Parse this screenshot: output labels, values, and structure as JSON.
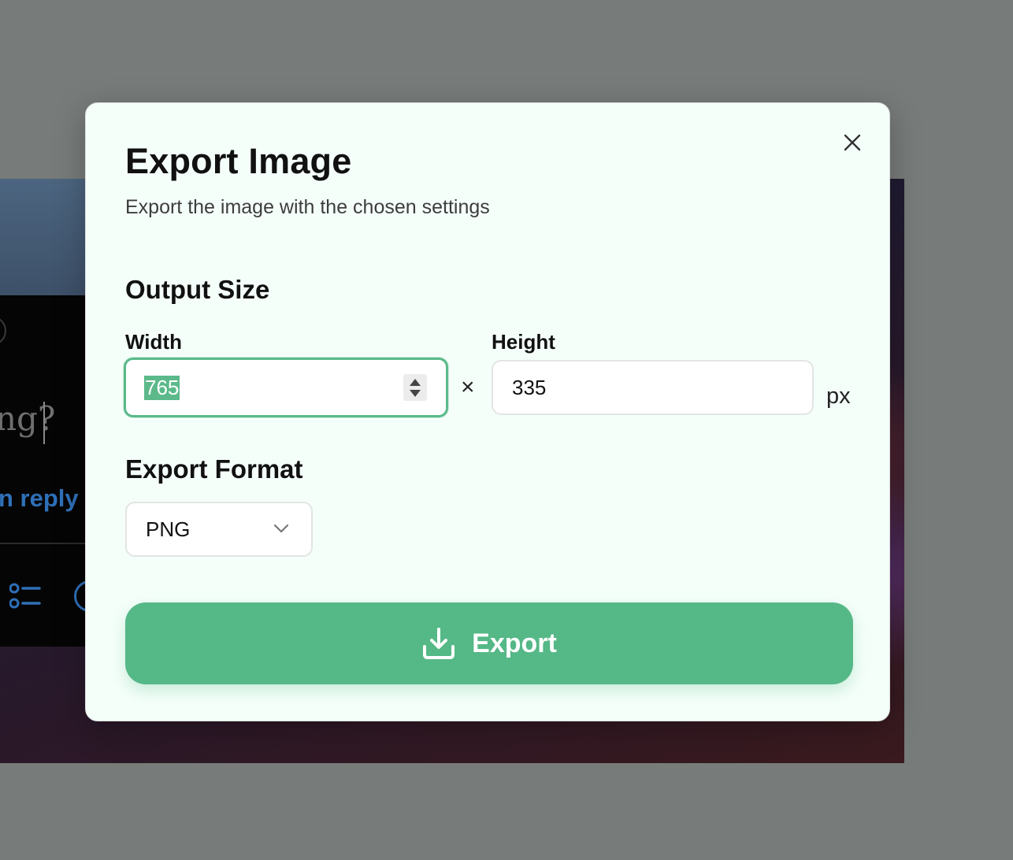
{
  "background": {
    "partial_text": "ng?",
    "partial_link": "n reply"
  },
  "dialog": {
    "title": "Export Image",
    "subtitle": "Export the image with the chosen settings",
    "output_size": {
      "heading": "Output Size",
      "width_label": "Width",
      "width_value": "765",
      "height_label": "Height",
      "height_value": "335",
      "separator": "×",
      "unit": "px"
    },
    "export_format": {
      "heading": "Export Format",
      "selected": "PNG"
    },
    "export_button_label": "Export",
    "colors": {
      "accent": "#55b887",
      "dialog_bg": "#f5fffa",
      "overlay": "#777b79"
    },
    "icons": [
      "close-icon",
      "spinner-up-icon",
      "spinner-down-icon",
      "chevron-down-icon",
      "download-icon"
    ]
  }
}
